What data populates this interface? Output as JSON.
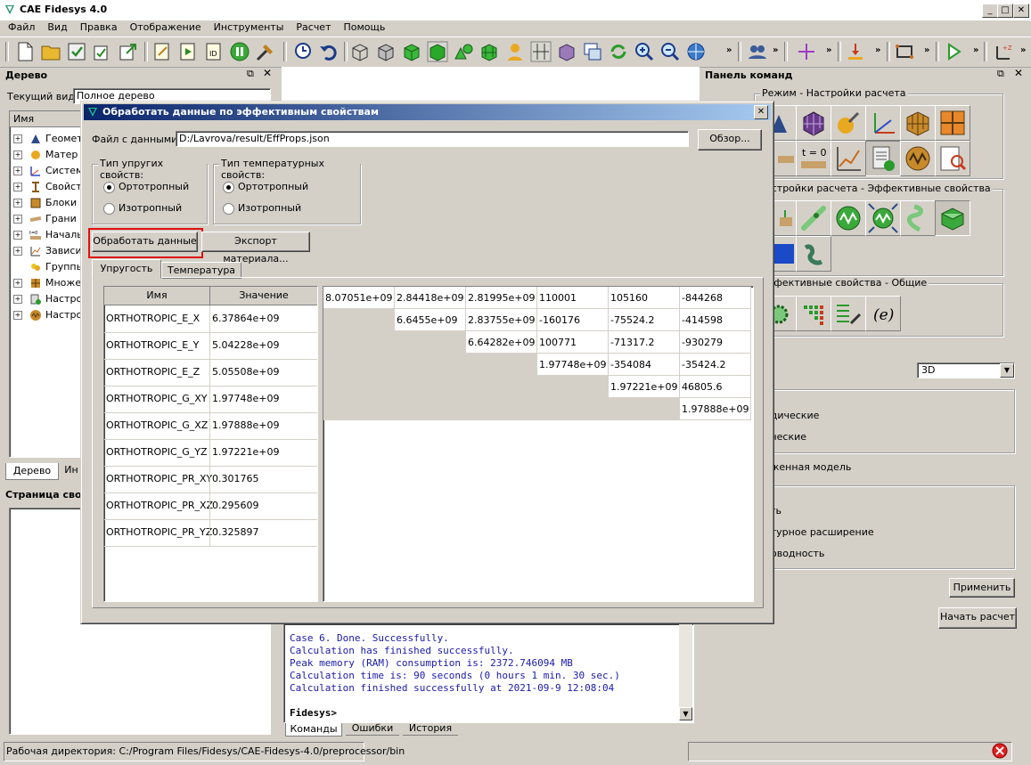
{
  "window": {
    "title": "CAE Fidesys 4.0"
  },
  "menu": [
    "Файл",
    "Вид",
    "Правка",
    "Отображение",
    "Инструменты",
    "Расчет",
    "Помощь"
  ],
  "tree_panel": {
    "header": "Дерево",
    "view_label": "Текущий вид",
    "view_value": "Полное дерево",
    "col_name": "Имя",
    "items": [
      "Геомет",
      "Матер",
      "Систем",
      "Свойст",
      "Блоки",
      "Грани",
      "Началь",
      "Зависи",
      "Группь",
      "Множе",
      "Настро",
      "Настро"
    ],
    "tabs": [
      "Дерево",
      "Ин"
    ],
    "props_header": "Страница свой"
  },
  "command_panel": {
    "header": "Панель команд",
    "group1": "Режим - Настройки расчета",
    "group2": "астройки расчета - Эффективные свойства",
    "group3": "ффективные свойства - Общие",
    "t0": "t = 0",
    "dim_value": "3D",
    "opt1": "одические",
    "opt2": "ические",
    "opt3": "уженная модель",
    "opt4": "сть",
    "opt5": "атурное расширение",
    "opt6": "роводность",
    "apply_btn": "Применить",
    "start_btn": "Начать расчет"
  },
  "console": {
    "lines": [
      "Case 6. Done. Successfully.",
      "Calculation has finished successfully.",
      "Peak memory (RAM) consumption is: 2372.746094 MB",
      "Calculation time is: 90 seconds (0 hours 1 min. 30 sec.)",
      "Calculation finished successfully at 2021-09-9 12:08:04"
    ],
    "prompt": "Fidesys>",
    "tabs": [
      "Команды",
      "Ошибки",
      "История"
    ]
  },
  "status": {
    "workdir": "Рабочая директория: C:/Program Files/Fidesys/CAE-Fidesys-4.0/preprocessor/bin"
  },
  "dialog": {
    "title": "Обработать данные по эффективным свойствам",
    "file_label": "Файл с данными:",
    "file_value": "D:/Lavrova/result/EffProps.json",
    "browse_btn": "Обзор...",
    "elastic_group": "Тип упругих свойств:",
    "thermal_group": "Тип температурных свойств:",
    "ortho": "Ортотропный",
    "iso": "Изотропный",
    "process_btn": "Обработать данные",
    "export_btn": "Экспорт материала...",
    "tabs": [
      "Упругость",
      "Температура"
    ],
    "col_name": "Имя",
    "col_value": "Значение",
    "props": [
      {
        "name": "ORTHOTROPIC_E_X",
        "value": "6.37864e+09"
      },
      {
        "name": "ORTHOTROPIC_E_Y",
        "value": "5.04228e+09"
      },
      {
        "name": "ORTHOTROPIC_E_Z",
        "value": "5.05508e+09"
      },
      {
        "name": "ORTHOTROPIC_G_XY",
        "value": "1.97748e+09"
      },
      {
        "name": "ORTHOTROPIC_G_XZ",
        "value": "1.97888e+09"
      },
      {
        "name": "ORTHOTROPIC_G_YZ",
        "value": "1.97221e+09"
      },
      {
        "name": "ORTHOTROPIC_PR_XY",
        "value": "0.301765"
      },
      {
        "name": "ORTHOTROPIC_PR_XZ",
        "value": "0.295609"
      },
      {
        "name": "ORTHOTROPIC_PR_YZ",
        "value": "0.325897"
      }
    ],
    "matrix": [
      [
        "8.07051e+09",
        "2.84418e+09",
        "2.81995e+09",
        "110001",
        "105160",
        "-844268"
      ],
      [
        "",
        "6.6455e+09",
        "2.83755e+09",
        "-160176",
        "-75524.2",
        "-414598"
      ],
      [
        "",
        "",
        "6.64282e+09",
        "100771",
        "-71317.2",
        "-930279"
      ],
      [
        "",
        "",
        "",
        "1.97748e+09",
        "-354084",
        "-35424.2"
      ],
      [
        "",
        "",
        "",
        "",
        "1.97221e+09",
        "46805.6"
      ],
      [
        "",
        "",
        "",
        "",
        "",
        "1.97888e+09"
      ]
    ]
  }
}
